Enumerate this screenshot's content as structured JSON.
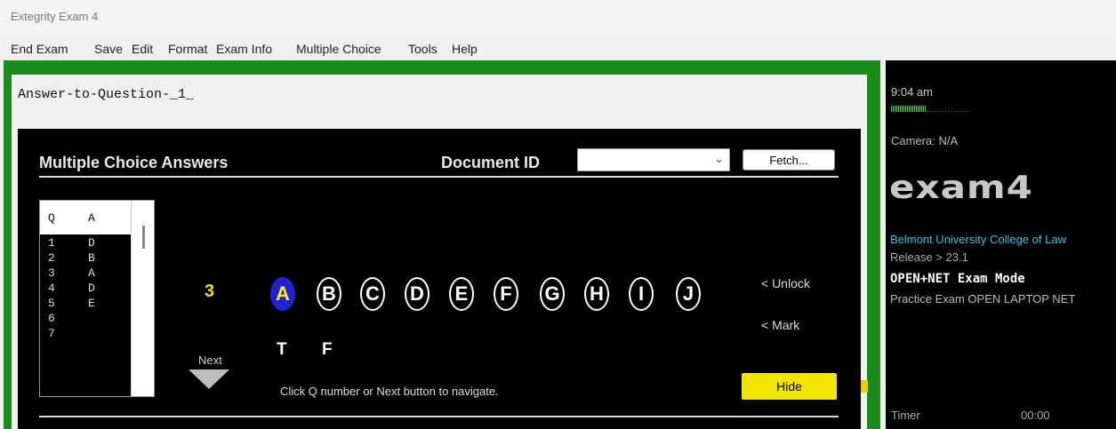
{
  "window": {
    "title": "Extegrity Exam 4"
  },
  "menu": [
    "End Exam",
    "Save",
    "Edit",
    "Format",
    "Exam Info",
    "Multiple Choice",
    "Tools",
    "Help"
  ],
  "document": {
    "header": "Answer-to-Question-_1_"
  },
  "mc": {
    "title": "Multiple Choice Answers",
    "document_id_label": "Document ID",
    "document_id_value": "",
    "fetch_label": "Fetch...",
    "table_headers": {
      "q": "Q",
      "a": "A"
    },
    "rows": [
      {
        "q": "1",
        "a": "D"
      },
      {
        "q": "2",
        "a": "B"
      },
      {
        "q": "3",
        "a": "A"
      },
      {
        "q": "4",
        "a": "D"
      },
      {
        "q": "5",
        "a": "E"
      },
      {
        "q": "6",
        "a": ""
      },
      {
        "q": "7",
        "a": ""
      }
    ],
    "current_question": "3",
    "next_label": "Next",
    "choices": [
      "A",
      "B",
      "C",
      "D",
      "E",
      "F",
      "G",
      "H",
      "I",
      "J"
    ],
    "selected_choice": "A",
    "true_false": [
      "T",
      "F"
    ],
    "unlock_label": "< Unlock",
    "mark_label": "< Mark",
    "hide_label": "Hide",
    "hint": "Click Q number or Next button to navigate."
  },
  "sidebar": {
    "time": "9:04 am",
    "camera": "Camera: N/A",
    "logo": "exam4",
    "school": "Belmont University College of Law",
    "release": "Release > 23.1",
    "mode": "OPEN+NET Exam Mode",
    "exam_name": "Practice Exam OPEN LAPTOP NET",
    "timer_label": "Timer",
    "timer_value": "00:00"
  },
  "colors": {
    "frame_green": "#198c19",
    "selected_choice_bg": "#2020d8",
    "accent_yellow": "#f2e500",
    "school_cyan": "#2fc3e8"
  }
}
